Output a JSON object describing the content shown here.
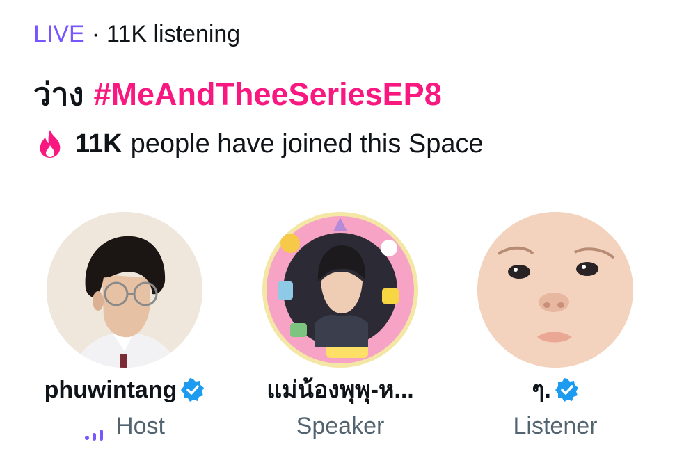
{
  "header": {
    "live_label": "LIVE",
    "separator": "·",
    "listening": "11K listening"
  },
  "title": {
    "prefix": "ว่าง",
    "hashtag": "#MeAndTheeSeriesEP8"
  },
  "joined": {
    "icon": "fire-icon",
    "count": "11K",
    "text": "people have joined this Space"
  },
  "participants": [
    {
      "name": "phuwintang",
      "verified": true,
      "role": "Host",
      "role_icon": "audio-bars-icon",
      "avatar": "avatar-photo"
    },
    {
      "name": "แม่น้องพุพุ-ห...",
      "verified": false,
      "role": "Speaker",
      "avatar": "avatar-photo"
    },
    {
      "name": "ๆ.",
      "verified": true,
      "role": "Listener",
      "avatar": "avatar-photo"
    }
  ],
  "colors": {
    "live": "#7856ff",
    "hashtag": "#f91880",
    "verified": "#1d9bf0",
    "secondary_text": "#536471",
    "fire": "#f91880"
  }
}
